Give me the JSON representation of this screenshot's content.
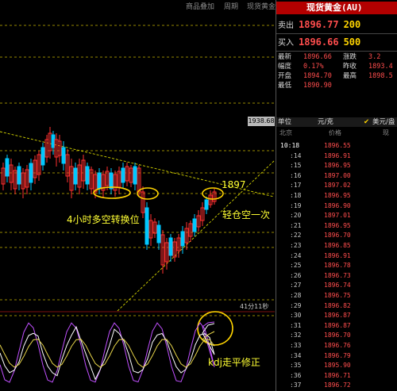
{
  "chart": {
    "top_links": {
      "item1": "商品叠加",
      "item2": "周期",
      "item3": "现货黄金"
    },
    "price_tag": "1938.68",
    "time_remaining": "41分11秒",
    "annotations": {
      "level_1897": "1897",
      "swing_4h": "4小时多空转换位",
      "light_short": "轻仓空一次",
      "kdj_note": "kdj走平修正"
    },
    "colors": {
      "up": "#ff3030",
      "down": "#00c8ff",
      "annotation": "#ffff33",
      "circle": "#ffd400",
      "trend": "#d4d400"
    }
  },
  "panel": {
    "title": "现货黄金(AU)",
    "sell": {
      "label": "卖出",
      "price": "1896.77",
      "volume": "200"
    },
    "buy": {
      "label": "买入",
      "price": "1896.66",
      "volume": "500"
    },
    "stats": [
      {
        "k": "最新",
        "v": "1896.66",
        "k2": "涨跌",
        "v2": "3.2"
      },
      {
        "k": "幅度",
        "v": "0.17%",
        "k2": "昨收",
        "v2": "1893.4"
      },
      {
        "k": "开盘",
        "v": "1894.70",
        "k2": "最高",
        "v2": "1898.5"
      },
      {
        "k": "最低",
        "v": "1890.90",
        "k2": "",
        "v2": ""
      }
    ],
    "unit_label": "单位",
    "unit_value": "元/克",
    "overlay_option": "美元/盎",
    "table_headers": {
      "time": "北京",
      "price": "价格",
      "extra": "现"
    },
    "ticks": [
      {
        "t": "10:18",
        "p": "1896.55"
      },
      {
        "t": ":14",
        "p": "1896.91"
      },
      {
        "t": ":15",
        "p": "1896.95"
      },
      {
        "t": ":16",
        "p": "1897.00"
      },
      {
        "t": ":17",
        "p": "1897.02"
      },
      {
        "t": ":18",
        "p": "1896.95"
      },
      {
        "t": ":19",
        "p": "1896.90"
      },
      {
        "t": ":20",
        "p": "1897.01"
      },
      {
        "t": ":21",
        "p": "1896.95"
      },
      {
        "t": ":22",
        "p": "1896.70"
      },
      {
        "t": ":23",
        "p": "1896.85"
      },
      {
        "t": ":24",
        "p": "1896.91"
      },
      {
        "t": ":25",
        "p": "1896.78"
      },
      {
        "t": ":26",
        "p": "1896.73"
      },
      {
        "t": ":27",
        "p": "1896.74"
      },
      {
        "t": ":28",
        "p": "1896.75"
      },
      {
        "t": ":29",
        "p": "1896.82"
      },
      {
        "t": ":30",
        "p": "1896.87"
      },
      {
        "t": ":31",
        "p": "1896.87"
      },
      {
        "t": ":32",
        "p": "1896.70"
      },
      {
        "t": ":33",
        "p": "1896.76"
      },
      {
        "t": ":34",
        "p": "1896.79"
      },
      {
        "t": ":35",
        "p": "1895.90"
      },
      {
        "t": ":36",
        "p": "1896.71"
      },
      {
        "t": ":37",
        "p": "1896.72"
      }
    ]
  }
}
